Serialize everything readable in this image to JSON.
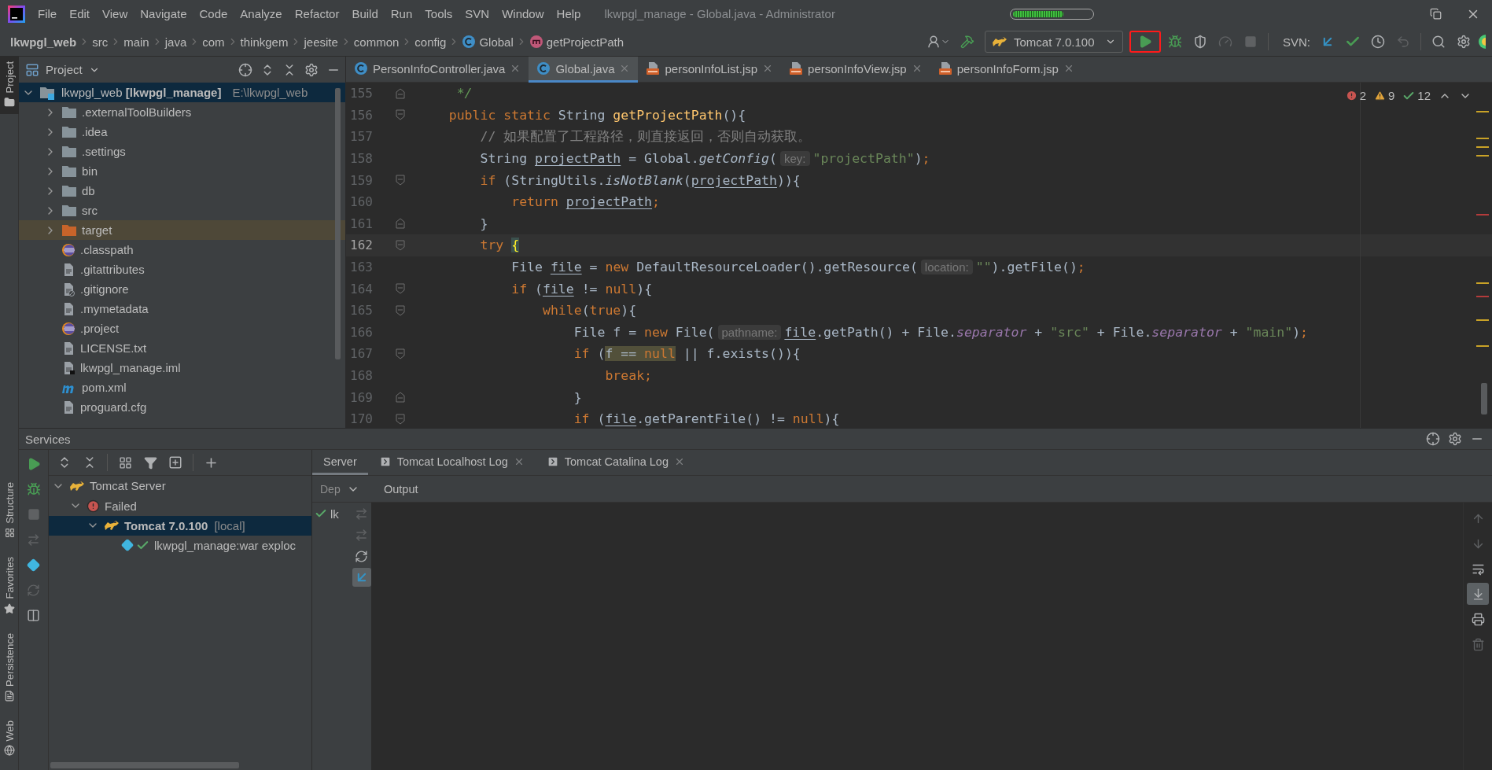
{
  "menu": {
    "items": [
      "File",
      "Edit",
      "View",
      "Navigate",
      "Code",
      "Analyze",
      "Refactor",
      "Build",
      "Run",
      "Tools",
      "SVN",
      "Window",
      "Help"
    ]
  },
  "window": {
    "title": "lkwpgl_manage - Global.java - Administrator"
  },
  "memory_indicator": {
    "level": 0.65
  },
  "breadcrumb": [
    {
      "label": "lkwpgl_web",
      "kind": "module"
    },
    {
      "label": "src",
      "kind": "folder"
    },
    {
      "label": "main",
      "kind": "folder"
    },
    {
      "label": "java",
      "kind": "folder"
    },
    {
      "label": "com",
      "kind": "folder"
    },
    {
      "label": "thinkgem",
      "kind": "folder"
    },
    {
      "label": "jeesite",
      "kind": "folder"
    },
    {
      "label": "common",
      "kind": "folder"
    },
    {
      "label": "config",
      "kind": "folder"
    },
    {
      "label": "Global",
      "kind": "class"
    },
    {
      "label": "getProjectPath",
      "kind": "method"
    }
  ],
  "toolbar": {
    "run_config": "Tomcat 7.0.100",
    "actions": [
      {
        "kind": "run",
        "disabled": false,
        "outlined": true
      },
      {
        "kind": "debug",
        "disabled": false,
        "outlined": false
      },
      {
        "kind": "coverage",
        "disabled": false,
        "outlined": false
      },
      {
        "kind": "profile",
        "disabled": true,
        "outlined": false
      },
      {
        "kind": "stop",
        "disabled": true,
        "outlined": false
      }
    ],
    "svn_label": "SVN:",
    "svn_actions": [
      {
        "kind": "update",
        "disabled": false
      },
      {
        "kind": "commit",
        "disabled": false
      },
      {
        "kind": "history",
        "disabled": false
      },
      {
        "kind": "rollback",
        "disabled": true
      }
    ]
  },
  "left_stripe": {
    "top": [
      {
        "label": "Project",
        "kind": "project",
        "selected": true
      }
    ],
    "bottom": [
      {
        "label": "Structure",
        "kind": "structure",
        "selected": false
      },
      {
        "label": "Favorites",
        "kind": "favorites",
        "selected": false
      },
      {
        "label": "Persistence",
        "kind": "persistence",
        "selected": false
      },
      {
        "label": "Web",
        "kind": "web",
        "selected": false
      }
    ]
  },
  "project": {
    "title": "Project",
    "tree": [
      {
        "label": "lkwpgl_web **[lkwpgl_manage]**",
        "path": "E:\\lkwpgl_web",
        "kind": "module",
        "expanded": true,
        "selected": true,
        "children": [
          {
            "label": ".externalToolBuilders",
            "kind": "folder",
            "expanded": false,
            "selected": false
          },
          {
            "label": ".idea",
            "kind": "folder",
            "expanded": false,
            "selected": false
          },
          {
            "label": ".settings",
            "kind": "folder",
            "expanded": false,
            "selected": false
          },
          {
            "label": "bin",
            "kind": "folder",
            "expanded": false,
            "selected": false
          },
          {
            "label": "db",
            "kind": "folder",
            "expanded": false,
            "selected": false
          },
          {
            "label": "src",
            "kind": "folder",
            "expanded": false,
            "selected": false
          },
          {
            "label": "target",
            "kind": "excluded-folder",
            "expanded": false,
            "selected": false
          },
          {
            "label": ".classpath",
            "kind": "eclipse",
            "selected": false
          },
          {
            "label": ".gitattributes",
            "kind": "text",
            "selected": false
          },
          {
            "label": ".gitignore",
            "kind": "ignore",
            "selected": false
          },
          {
            "label": ".mymetadata",
            "kind": "text",
            "selected": false
          },
          {
            "label": ".project",
            "kind": "eclipse",
            "selected": false
          },
          {
            "label": "LICENSE.txt",
            "kind": "text",
            "selected": false
          },
          {
            "label": "lkwpgl_manage.iml",
            "kind": "iml",
            "selected": false
          },
          {
            "label": "pom.xml",
            "kind": "maven",
            "selected": false
          },
          {
            "label": "proguard.cfg",
            "kind": "text",
            "selected": false
          }
        ]
      }
    ]
  },
  "editor": {
    "tabs": [
      {
        "label": "PersonInfoController.java",
        "kind": "class",
        "selected": false
      },
      {
        "label": "Global.java",
        "kind": "class",
        "selected": true
      },
      {
        "label": "personInfoList.jsp",
        "kind": "jsp",
        "selected": false
      },
      {
        "label": "personInfoView.jsp",
        "kind": "jsp",
        "selected": false
      },
      {
        "label": "personInfoForm.jsp",
        "kind": "jsp",
        "selected": false
      }
    ],
    "inspections": {
      "errors": "2",
      "warnings": "9",
      "typos": "12"
    },
    "lines": [
      {
        "number": "155",
        "current": false,
        "folding": {
          "kind": "end"
        },
        "tokens": [
          {
            "text": "     */",
            "kind": "doc"
          }
        ]
      },
      {
        "number": "156",
        "current": false,
        "folding": {
          "kind": "start"
        },
        "tokens": [
          {
            "text": "    public static ",
            "kind": "keyword"
          },
          {
            "text": "String ",
            "kind": "plain"
          },
          {
            "text": "getProjectPath",
            "kind": "method"
          },
          {
            "text": "(){",
            "kind": "plain"
          }
        ]
      },
      {
        "number": "157",
        "current": false,
        "tokens": [
          {
            "text": "        // 如果配置了工程路径，则直接返回，否则自动获取。",
            "kind": "comment"
          }
        ]
      },
      {
        "number": "158",
        "current": false,
        "tokens": [
          {
            "text": "        String ",
            "kind": "plain"
          },
          {
            "text": "projectPath",
            "kind": "local"
          },
          {
            "text": " = Global.",
            "kind": "plain"
          },
          {
            "text": "getConfig",
            "kind": "static"
          },
          {
            "text": "(",
            "kind": "plain"
          },
          {
            "text": "key:",
            "kind": "hint"
          },
          {
            "text": "\"projectPath\"",
            "kind": "string"
          },
          {
            "text": ")",
            "kind": "plain"
          },
          {
            "text": ";",
            "kind": "keyword"
          }
        ]
      },
      {
        "number": "159",
        "current": false,
        "folding": {
          "kind": "start"
        },
        "tokens": [
          {
            "text": "        if ",
            "kind": "keyword"
          },
          {
            "text": "(StringUtils.",
            "kind": "plain"
          },
          {
            "text": "isNotBlank",
            "kind": "static"
          },
          {
            "text": "(",
            "kind": "plain"
          },
          {
            "text": "projectPath",
            "kind": "local"
          },
          {
            "text": ")){",
            "kind": "plain"
          }
        ]
      },
      {
        "number": "160",
        "current": false,
        "tokens": [
          {
            "text": "            return ",
            "kind": "keyword"
          },
          {
            "text": "projectPath",
            "kind": "local"
          },
          {
            "text": ";",
            "kind": "keyword"
          }
        ]
      },
      {
        "number": "161",
        "current": false,
        "folding": {
          "kind": "end"
        },
        "tokens": [
          {
            "text": "        }",
            "kind": "plain"
          }
        ]
      },
      {
        "number": "162",
        "current": true,
        "folding": {
          "kind": "start"
        },
        "tokens": [
          {
            "text": "        try ",
            "kind": "keyword"
          },
          {
            "text": "{",
            "kind": "brace"
          }
        ]
      },
      {
        "number": "163",
        "current": false,
        "tokens": [
          {
            "text": "            File ",
            "kind": "plain"
          },
          {
            "text": "file",
            "kind": "local"
          },
          {
            "text": " = ",
            "kind": "plain"
          },
          {
            "text": "new ",
            "kind": "keyword"
          },
          {
            "text": "DefaultResourceLoader().getResource(",
            "kind": "plain"
          },
          {
            "text": "location:",
            "kind": "hint"
          },
          {
            "text": "\"\"",
            "kind": "string"
          },
          {
            "text": ").getFile()",
            "kind": "plain"
          },
          {
            "text": ";",
            "kind": "keyword"
          }
        ]
      },
      {
        "number": "164",
        "current": false,
        "folding": {
          "kind": "start"
        },
        "tokens": [
          {
            "text": "            if ",
            "kind": "keyword"
          },
          {
            "text": "(",
            "kind": "plain"
          },
          {
            "text": "file",
            "kind": "local"
          },
          {
            "text": " != ",
            "kind": "plain"
          },
          {
            "text": "null",
            "kind": "keyword"
          },
          {
            "text": "){",
            "kind": "plain"
          }
        ]
      },
      {
        "number": "165",
        "current": false,
        "folding": {
          "kind": "start"
        },
        "tokens": [
          {
            "text": "                while",
            "kind": "keyword"
          },
          {
            "text": "(",
            "kind": "plain"
          },
          {
            "text": "true",
            "kind": "keyword"
          },
          {
            "text": "){",
            "kind": "plain"
          }
        ]
      },
      {
        "number": "166",
        "current": false,
        "tokens": [
          {
            "text": "                    File f = ",
            "kind": "plain"
          },
          {
            "text": "new ",
            "kind": "keyword"
          },
          {
            "text": "File(",
            "kind": "plain"
          },
          {
            "text": "pathname:",
            "kind": "hint"
          },
          {
            "text": "file",
            "kind": "local"
          },
          {
            "text": ".getPath() + File.",
            "kind": "plain"
          },
          {
            "text": "separator",
            "kind": "field"
          },
          {
            "text": " + ",
            "kind": "plain"
          },
          {
            "text": "\"src\"",
            "kind": "string"
          },
          {
            "text": " + File.",
            "kind": "plain"
          },
          {
            "text": "separator",
            "kind": "field"
          },
          {
            "text": " + ",
            "kind": "plain"
          },
          {
            "text": "\"main\"",
            "kind": "string"
          },
          {
            "text": ")",
            "kind": "plain"
          },
          {
            "text": ";",
            "kind": "keyword"
          }
        ]
      },
      {
        "number": "167",
        "current": false,
        "folding": {
          "kind": "start"
        },
        "tokens": [
          {
            "text": "                    if ",
            "kind": "keyword"
          },
          {
            "text": "(",
            "kind": "plain"
          },
          {
            "text": "f == ",
            "kind": "plain",
            "highlighted": true
          },
          {
            "text": "null",
            "kind": "keyword",
            "highlighted": true
          },
          {
            "text": " || f.exists()){",
            "kind": "plain"
          }
        ]
      },
      {
        "number": "168",
        "current": false,
        "tokens": [
          {
            "text": "                        break;",
            "kind": "keyword"
          }
        ]
      },
      {
        "number": "169",
        "current": false,
        "folding": {
          "kind": "end"
        },
        "tokens": [
          {
            "text": "                    }",
            "kind": "plain"
          }
        ]
      },
      {
        "number": "170",
        "current": false,
        "folding": {
          "kind": "start"
        },
        "tokens": [
          {
            "text": "                    if ",
            "kind": "keyword"
          },
          {
            "text": "(",
            "kind": "plain"
          },
          {
            "text": "file",
            "kind": "local"
          },
          {
            "text": ".getParentFile() != ",
            "kind": "plain"
          },
          {
            "text": "null",
            "kind": "keyword"
          },
          {
            "text": "){",
            "kind": "plain"
          }
        ]
      }
    ]
  },
  "services": {
    "title": "Services",
    "side_actions": [
      {
        "kind": "run",
        "disabled": false
      },
      {
        "kind": "debug",
        "disabled": false
      },
      {
        "kind": "stop",
        "disabled": true
      },
      {
        "kind": "deploy",
        "disabled": true
      },
      {
        "kind": "artifact",
        "disabled": false
      },
      {
        "kind": "restart",
        "disabled": true
      },
      {
        "kind": "layout",
        "disabled": false
      }
    ],
    "tree": [
      {
        "label": "Tomcat Server",
        "kind": "server-type",
        "expanded": true,
        "selected": false,
        "children": [
          {
            "label": "Failed",
            "kind": "error-group",
            "expanded": true,
            "selected": false,
            "children": [
              {
                "label": "Tomcat 7.0.100",
                "suffix": "[local]",
                "kind": "server",
                "expanded": true,
                "selected": true,
                "children": [
                  {
                    "label": "lkwpgl_manage:war exploc",
                    "kind": "artifact",
                    "selected": false
                  }
                ]
              }
            ]
          }
        ]
      }
    ],
    "detail_tabs": [
      {
        "label": "Server",
        "kind": "plain",
        "selected": true
      },
      {
        "label": "Tomcat Localhost Log",
        "kind": "log",
        "selected": false
      },
      {
        "label": "Tomcat Catalina Log",
        "kind": "log",
        "selected": false
      }
    ],
    "deployments": {
      "header": "Dep",
      "items": [
        {
          "label": "lk",
          "kind": "deployed"
        }
      ]
    },
    "deploy_actions": [
      {
        "kind": "deploy",
        "disabled": true,
        "active": false
      },
      {
        "kind": "undeploy",
        "disabled": true,
        "active": false
      },
      {
        "kind": "refresh",
        "disabled": false,
        "active": false
      },
      {
        "kind": "update",
        "disabled": false,
        "active": true
      }
    ],
    "output": {
      "title": "Output"
    },
    "output_actions": [
      {
        "kind": "up",
        "disabled": true,
        "active": false
      },
      {
        "kind": "down",
        "disabled": true,
        "active": false
      },
      {
        "kind": "wrap",
        "disabled": false,
        "active": false
      },
      {
        "kind": "scroll-end",
        "disabled": false,
        "active": true
      },
      {
        "kind": "print",
        "disabled": false,
        "active": false
      },
      {
        "kind": "clear",
        "disabled": true,
        "active": false
      }
    ]
  }
}
